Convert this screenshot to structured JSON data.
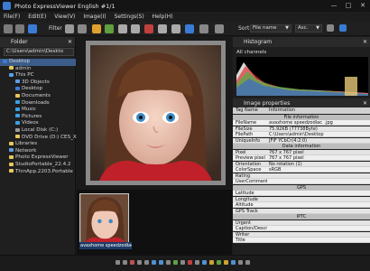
{
  "app": {
    "title": "Photo ExpressViewer English  #1/1",
    "win_min": "—",
    "win_max": "□",
    "win_close": "✕"
  },
  "menu": [
    "File(F)",
    "Edit(E)",
    "View(V)",
    "Image(I)",
    "Settings(S)",
    "Help(H)"
  ],
  "toolbar": {
    "filter_label": "Filter",
    "sort_label": "Sort",
    "sort_value": "File name",
    "order_value": "Asc."
  },
  "folder_panel": {
    "title": "Folder",
    "path": "C:\\Users\\admin\\Deskto",
    "items": [
      {
        "label": "Desktop",
        "depth": 0,
        "selected": true,
        "color": "#3a7bd5"
      },
      {
        "label": "admin",
        "depth": 1,
        "color": "#e8c85a"
      },
      {
        "label": "This PC",
        "depth": 1,
        "color": "#5aa0e8"
      },
      {
        "label": "3D Objects",
        "depth": 2,
        "color": "#5aa0e8"
      },
      {
        "label": "Desktop",
        "depth": 2,
        "color": "#3a7bd5"
      },
      {
        "label": "Documents",
        "depth": 2,
        "color": "#e8c85a"
      },
      {
        "label": "Downloads",
        "depth": 2,
        "color": "#3aa0e8"
      },
      {
        "label": "Music",
        "depth": 2,
        "color": "#3aa0e8"
      },
      {
        "label": "Pictures",
        "depth": 2,
        "color": "#3aa0e8"
      },
      {
        "label": "Videos",
        "depth": 2,
        "color": "#3aa0e8"
      },
      {
        "label": "Local Disk (C:)",
        "depth": 2,
        "color": "#9a9a9a"
      },
      {
        "label": "DVD Drive (D:) CES_X64F",
        "depth": 2,
        "color": "#e8c85a"
      },
      {
        "label": "Libraries",
        "depth": 1,
        "color": "#e8c85a"
      },
      {
        "label": "Network",
        "depth": 1,
        "color": "#5aa0e8"
      },
      {
        "label": "Photo ExpressViewer",
        "depth": 1,
        "color": "#e8c85a"
      },
      {
        "label": "StudioPortable_22.4.2",
        "depth": 1,
        "color": "#e8c85a"
      },
      {
        "label": "ThinApp.2203.Portable",
        "depth": 1,
        "color": "#e8c85a"
      }
    ]
  },
  "thumbnail": {
    "caption": "avaxhome speedzodiac_"
  },
  "histogram": {
    "title": "Histogram",
    "channel": "All channels"
  },
  "properties": {
    "title": "Image properties",
    "col_name": "Tag Name",
    "col_info": "Information",
    "rows": [
      {
        "type": "section",
        "label": "File information"
      },
      {
        "type": "item",
        "key": "FileName",
        "value": "avaxhome speedzodiac_.jpg"
      },
      {
        "type": "item",
        "key": "FileSize",
        "value": "75.92KB (77738Byte)"
      },
      {
        "type": "item",
        "key": "FilePath",
        "value": "C:\\Users\\admin\\Desktop"
      },
      {
        "type": "item",
        "key": "UniqueInfo",
        "value": "JFIF YCbCr(4:2:0)"
      },
      {
        "type": "section",
        "label": "Data information"
      },
      {
        "type": "item",
        "key": "Pixel",
        "value": "767 x 767 pixel"
      },
      {
        "type": "item",
        "key": "Preview pixel",
        "value": "767 x 767 pixel"
      },
      {
        "type": "item",
        "key": "Orientation",
        "value": "No rotation (1)"
      },
      {
        "type": "item",
        "key": "ColorSpace",
        "value": "sRGB"
      },
      {
        "type": "item",
        "key": "Rating",
        "value": ""
      },
      {
        "type": "item",
        "key": "UserComment",
        "value": ""
      },
      {
        "type": "section",
        "label": "GPS"
      },
      {
        "type": "item",
        "key": "Latitude",
        "value": ""
      },
      {
        "type": "item",
        "key": "Longitude",
        "value": ""
      },
      {
        "type": "item",
        "key": "Altitude",
        "value": ""
      },
      {
        "type": "item",
        "key": "GPS Track",
        "value": ""
      },
      {
        "type": "section",
        "label": "IPTC"
      },
      {
        "type": "item",
        "key": "Urgent",
        "value": ""
      },
      {
        "type": "item",
        "key": "Caption/Descri",
        "value": ""
      },
      {
        "type": "item",
        "key": "Writer",
        "value": ""
      },
      {
        "type": "item",
        "key": "Title",
        "value": ""
      }
    ]
  },
  "colors": {
    "accent": "#3a7bd5",
    "selection": "#3c5c8a"
  }
}
